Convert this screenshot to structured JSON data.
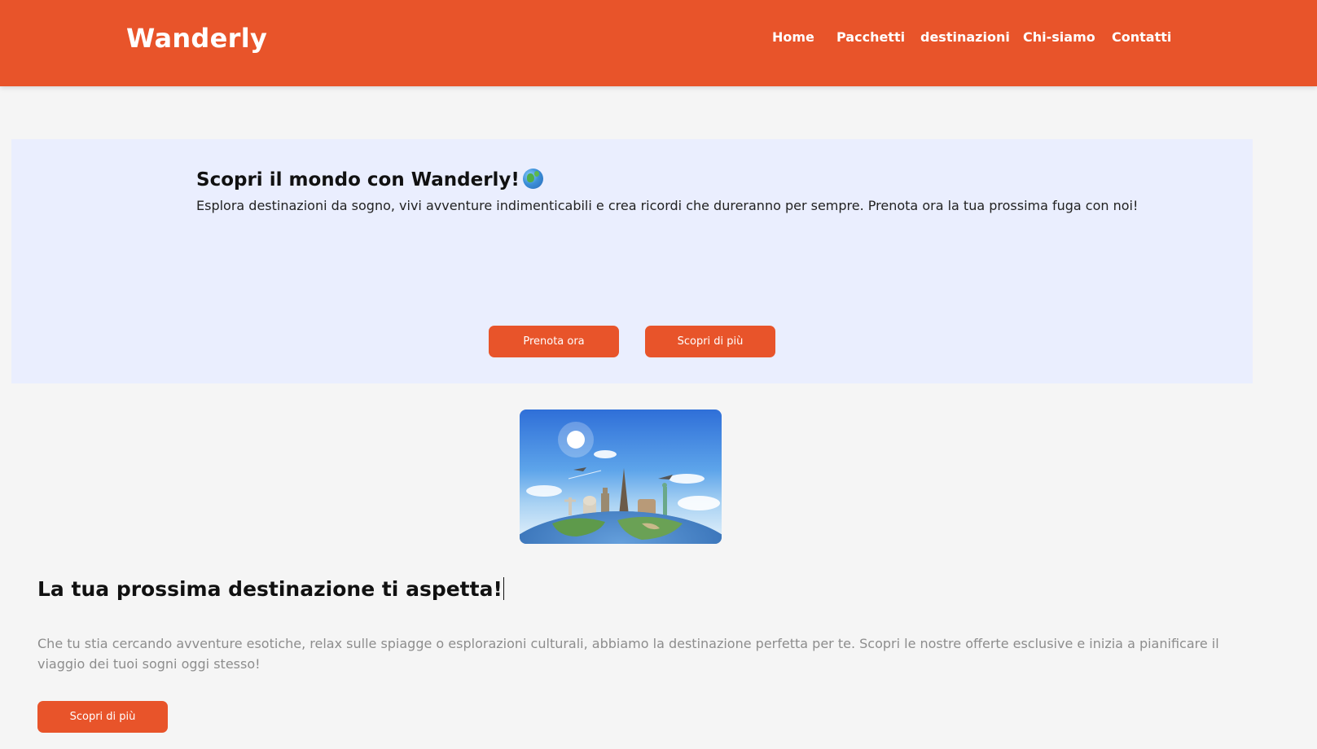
{
  "header": {
    "logo": "Wanderly",
    "nav": [
      "Home",
      "Pacchetti",
      "destinazioni",
      "Chi-siamo",
      "Contatti"
    ]
  },
  "hero": {
    "title": "Scopri il mondo con Wanderly!",
    "title_icon": "globe-emoji",
    "subtitle": "Esplora destinazioni da sogno, vivi avventure indimenticabili e crea ricordi che dureranno per sempre. Prenota ora la tua prossima fuga con noi!",
    "primary_button": "Prenota ora",
    "secondary_button": "Scopri di più"
  },
  "feature": {
    "image_icon": "world-landmarks-globe-image",
    "title": "La tua prossima destinazione ti aspetta!",
    "text": "Che tu stia cercando avventure esotiche, relax sulle spiagge o esplorazioni culturali, abbiamo la destinazione perfetta per te. Scopri le nostre offerte esclusive e inizia a pianificare il viaggio dei tuoi sogni oggi stesso!",
    "button": "Scopri di più"
  },
  "colors": {
    "accent": "#e8542a",
    "hero_background": "#eaeefe",
    "page_background": "#f5f5f5",
    "muted_text": "#8d8d8d"
  }
}
